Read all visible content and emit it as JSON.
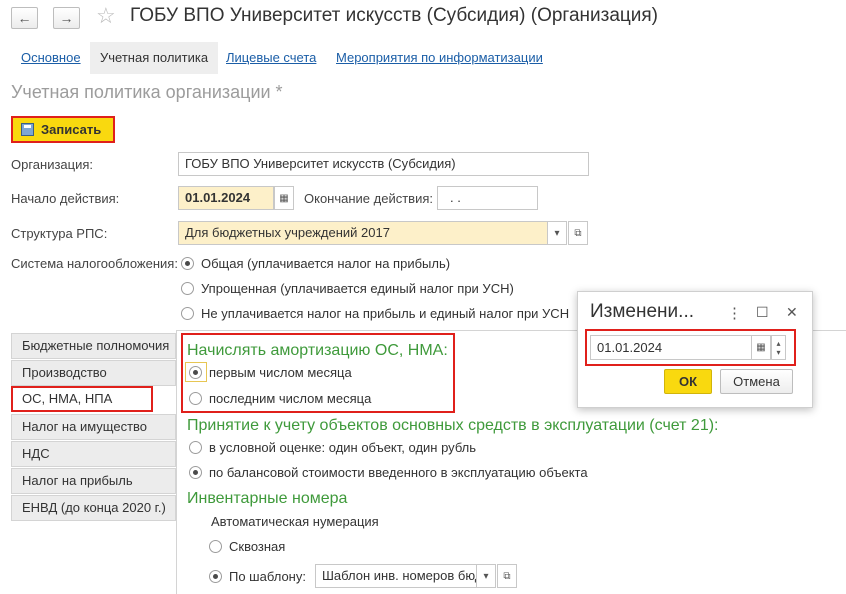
{
  "window": {
    "title": "ГОБУ ВПО Университет искусств (Субсидия) (Организация)",
    "back_icon": "←",
    "forward_icon": "→",
    "star_icon": "☆"
  },
  "tabs": [
    {
      "label": "Основное"
    },
    {
      "label": "Учетная политика"
    },
    {
      "label": "Лицевые счета"
    },
    {
      "label": "Мероприятия по информатизации"
    }
  ],
  "form": {
    "title": "Учетная политика организации *",
    "save_label": "Записать",
    "org_label": "Организация:",
    "org_value": "ГОБУ ВПО Университет искусств (Субсидия)",
    "start_label": "Начало действия:",
    "start_value": "01.01.2024",
    "end_label": "Окончание действия:",
    "end_value": ".  .",
    "rps_label": "Структура РПС:",
    "rps_value": "Для бюджетных учреждений 2017",
    "tax_label": "Система налогообложения:",
    "tax_options": [
      "Общая (уплачивается налог на прибыль)",
      "Упрощенная (уплачивается единый налог при УСН)",
      "Не уплачивается налог на прибыль и единый налог при УСН"
    ],
    "tax_selected": 0
  },
  "side_tabs": [
    "Бюджетные полномочия",
    "Производство",
    "ОС, НМА, НПА",
    "Налог на имущество",
    "НДС",
    "Налог на прибыль",
    "ЕНВД (до конца 2020 г.)"
  ],
  "side_selected": 2,
  "amort": {
    "heading": "Начислять амортизацию ОС, НМА:",
    "options": [
      "первым числом месяца",
      "последним числом месяца"
    ],
    "selected": 0
  },
  "accept": {
    "heading": "Принятие к учету объектов основных средств в эксплуатации (счет 21):",
    "options": [
      "в условной оценке: один объект, один рубль",
      "по балансовой стоимости введенного в эксплуатацию объекта"
    ],
    "selected": 1
  },
  "inventory": {
    "heading": "Инвентарные номера",
    "auto_label": "Автоматическая нумерация",
    "options": [
      "Сквозная",
      "По шаблону:"
    ],
    "selected": 1,
    "template_value": "Шаблон инв. номеров бюд"
  },
  "dialog": {
    "title": "Изменени...",
    "date_value": "01.01.2024",
    "ok_label": "ОК",
    "cancel_label": "Отмена",
    "more_icon": "⋮",
    "maximize_icon": "☐",
    "close_icon": "✕"
  },
  "colors": {
    "accent_yellow": "#f9d90f",
    "highlight_red": "#e0201b",
    "section_green": "#3f9a3b",
    "link_blue": "#1b5ea7"
  }
}
